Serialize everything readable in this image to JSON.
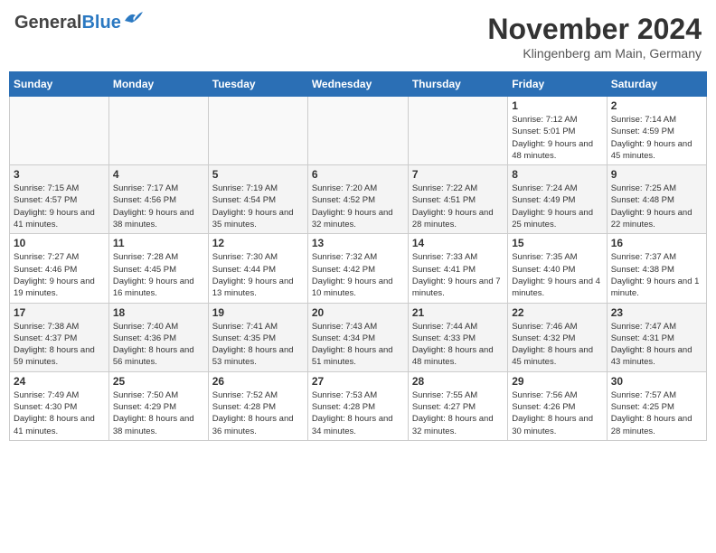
{
  "header": {
    "logo_general": "General",
    "logo_blue": "Blue",
    "month": "November 2024",
    "location": "Klingenberg am Main, Germany"
  },
  "days_of_week": [
    "Sunday",
    "Monday",
    "Tuesday",
    "Wednesday",
    "Thursday",
    "Friday",
    "Saturday"
  ],
  "weeks": [
    [
      {
        "day": "",
        "info": ""
      },
      {
        "day": "",
        "info": ""
      },
      {
        "day": "",
        "info": ""
      },
      {
        "day": "",
        "info": ""
      },
      {
        "day": "",
        "info": ""
      },
      {
        "day": "1",
        "info": "Sunrise: 7:12 AM\nSunset: 5:01 PM\nDaylight: 9 hours and 48 minutes."
      },
      {
        "day": "2",
        "info": "Sunrise: 7:14 AM\nSunset: 4:59 PM\nDaylight: 9 hours and 45 minutes."
      }
    ],
    [
      {
        "day": "3",
        "info": "Sunrise: 7:15 AM\nSunset: 4:57 PM\nDaylight: 9 hours and 41 minutes."
      },
      {
        "day": "4",
        "info": "Sunrise: 7:17 AM\nSunset: 4:56 PM\nDaylight: 9 hours and 38 minutes."
      },
      {
        "day": "5",
        "info": "Sunrise: 7:19 AM\nSunset: 4:54 PM\nDaylight: 9 hours and 35 minutes."
      },
      {
        "day": "6",
        "info": "Sunrise: 7:20 AM\nSunset: 4:52 PM\nDaylight: 9 hours and 32 minutes."
      },
      {
        "day": "7",
        "info": "Sunrise: 7:22 AM\nSunset: 4:51 PM\nDaylight: 9 hours and 28 minutes."
      },
      {
        "day": "8",
        "info": "Sunrise: 7:24 AM\nSunset: 4:49 PM\nDaylight: 9 hours and 25 minutes."
      },
      {
        "day": "9",
        "info": "Sunrise: 7:25 AM\nSunset: 4:48 PM\nDaylight: 9 hours and 22 minutes."
      }
    ],
    [
      {
        "day": "10",
        "info": "Sunrise: 7:27 AM\nSunset: 4:46 PM\nDaylight: 9 hours and 19 minutes."
      },
      {
        "day": "11",
        "info": "Sunrise: 7:28 AM\nSunset: 4:45 PM\nDaylight: 9 hours and 16 minutes."
      },
      {
        "day": "12",
        "info": "Sunrise: 7:30 AM\nSunset: 4:44 PM\nDaylight: 9 hours and 13 minutes."
      },
      {
        "day": "13",
        "info": "Sunrise: 7:32 AM\nSunset: 4:42 PM\nDaylight: 9 hours and 10 minutes."
      },
      {
        "day": "14",
        "info": "Sunrise: 7:33 AM\nSunset: 4:41 PM\nDaylight: 9 hours and 7 minutes."
      },
      {
        "day": "15",
        "info": "Sunrise: 7:35 AM\nSunset: 4:40 PM\nDaylight: 9 hours and 4 minutes."
      },
      {
        "day": "16",
        "info": "Sunrise: 7:37 AM\nSunset: 4:38 PM\nDaylight: 9 hours and 1 minute."
      }
    ],
    [
      {
        "day": "17",
        "info": "Sunrise: 7:38 AM\nSunset: 4:37 PM\nDaylight: 8 hours and 59 minutes."
      },
      {
        "day": "18",
        "info": "Sunrise: 7:40 AM\nSunset: 4:36 PM\nDaylight: 8 hours and 56 minutes."
      },
      {
        "day": "19",
        "info": "Sunrise: 7:41 AM\nSunset: 4:35 PM\nDaylight: 8 hours and 53 minutes."
      },
      {
        "day": "20",
        "info": "Sunrise: 7:43 AM\nSunset: 4:34 PM\nDaylight: 8 hours and 51 minutes."
      },
      {
        "day": "21",
        "info": "Sunrise: 7:44 AM\nSunset: 4:33 PM\nDaylight: 8 hours and 48 minutes."
      },
      {
        "day": "22",
        "info": "Sunrise: 7:46 AM\nSunset: 4:32 PM\nDaylight: 8 hours and 45 minutes."
      },
      {
        "day": "23",
        "info": "Sunrise: 7:47 AM\nSunset: 4:31 PM\nDaylight: 8 hours and 43 minutes."
      }
    ],
    [
      {
        "day": "24",
        "info": "Sunrise: 7:49 AM\nSunset: 4:30 PM\nDaylight: 8 hours and 41 minutes."
      },
      {
        "day": "25",
        "info": "Sunrise: 7:50 AM\nSunset: 4:29 PM\nDaylight: 8 hours and 38 minutes."
      },
      {
        "day": "26",
        "info": "Sunrise: 7:52 AM\nSunset: 4:28 PM\nDaylight: 8 hours and 36 minutes."
      },
      {
        "day": "27",
        "info": "Sunrise: 7:53 AM\nSunset: 4:28 PM\nDaylight: 8 hours and 34 minutes."
      },
      {
        "day": "28",
        "info": "Sunrise: 7:55 AM\nSunset: 4:27 PM\nDaylight: 8 hours and 32 minutes."
      },
      {
        "day": "29",
        "info": "Sunrise: 7:56 AM\nSunset: 4:26 PM\nDaylight: 8 hours and 30 minutes."
      },
      {
        "day": "30",
        "info": "Sunrise: 7:57 AM\nSunset: 4:25 PM\nDaylight: 8 hours and 28 minutes."
      }
    ]
  ]
}
